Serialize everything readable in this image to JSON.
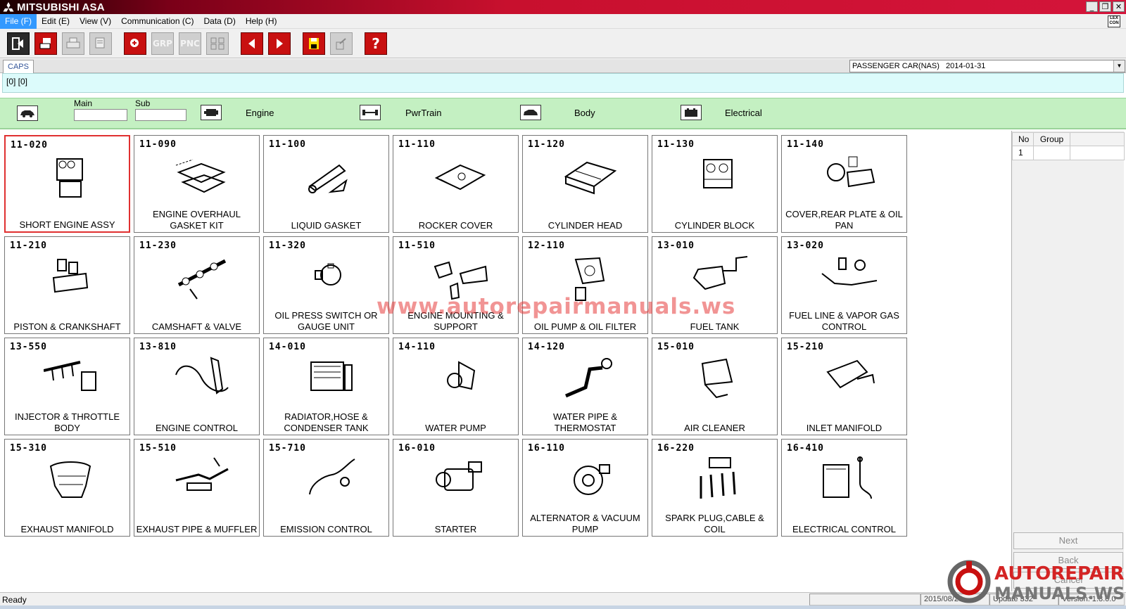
{
  "window": {
    "title": "MITSUBISHI ASA",
    "minimize": "_",
    "restore": "❐",
    "close": "✕"
  },
  "menu": [
    "File (F)",
    "Edit (E)",
    "View (V)",
    "Communication (C)",
    "Data (D)",
    "Help (H)"
  ],
  "menu_icon_text": "LEX CON",
  "toolbar": {
    "grp": "GRP",
    "pnc": "PNC",
    "help": "?"
  },
  "caps_tab": "CAPS",
  "vehicle": "PASSENGER CAR(NAS)   2014-01-31",
  "path": "[0] [0]",
  "category": {
    "main_label": "Main",
    "sub_label": "Sub",
    "engine": "Engine",
    "pwrtrain": "PwrTrain",
    "body": "Body",
    "electrical": "Electrical"
  },
  "tiles": [
    {
      "code": "11-020",
      "name": "SHORT ENGINE ASSY"
    },
    {
      "code": "11-090",
      "name": "ENGINE OVERHAUL GASKET KIT"
    },
    {
      "code": "11-100",
      "name": "LIQUID GASKET"
    },
    {
      "code": "11-110",
      "name": "ROCKER COVER"
    },
    {
      "code": "11-120",
      "name": "CYLINDER HEAD"
    },
    {
      "code": "11-130",
      "name": "CYLINDER BLOCK"
    },
    {
      "code": "11-140",
      "name": "COVER,REAR PLATE & OIL PAN"
    },
    {
      "code": "11-210",
      "name": "PISTON & CRANKSHAFT"
    },
    {
      "code": "11-230",
      "name": "CAMSHAFT & VALVE"
    },
    {
      "code": "11-320",
      "name": "OIL PRESS SWITCH OR GAUGE UNIT"
    },
    {
      "code": "11-510",
      "name": "ENGINE MOUNTING & SUPPORT"
    },
    {
      "code": "12-110",
      "name": "OIL PUMP & OIL FILTER"
    },
    {
      "code": "13-010",
      "name": "FUEL TANK"
    },
    {
      "code": "13-020",
      "name": "FUEL LINE & VAPOR GAS CONTROL"
    },
    {
      "code": "13-550",
      "name": "INJECTOR & THROTTLE BODY"
    },
    {
      "code": "13-810",
      "name": "ENGINE CONTROL"
    },
    {
      "code": "14-010",
      "name": "RADIATOR,HOSE & CONDENSER TANK"
    },
    {
      "code": "14-110",
      "name": "WATER PUMP"
    },
    {
      "code": "14-120",
      "name": "WATER PIPE & THERMOSTAT"
    },
    {
      "code": "15-010",
      "name": "AIR CLEANER"
    },
    {
      "code": "15-210",
      "name": "INLET MANIFOLD"
    },
    {
      "code": "15-310",
      "name": "EXHAUST MANIFOLD"
    },
    {
      "code": "15-510",
      "name": "EXHAUST PIPE & MUFFLER"
    },
    {
      "code": "15-710",
      "name": "EMISSION CONTROL"
    },
    {
      "code": "16-010",
      "name": "STARTER"
    },
    {
      "code": "16-110",
      "name": "ALTERNATOR & VACUUM PUMP"
    },
    {
      "code": "16-220",
      "name": "SPARK PLUG,CABLE & COIL"
    },
    {
      "code": "16-410",
      "name": "ELECTRICAL CONTROL"
    }
  ],
  "watermark": "www.autorepairmanuals.ws",
  "group_table": {
    "col_no": "No",
    "col_group": "Group",
    "rows": [
      {
        "no": "1",
        "group": ""
      }
    ]
  },
  "panel_buttons": {
    "next": "Next",
    "back": "Back",
    "cancel": "Cancel"
  },
  "status": {
    "ready": "Ready",
    "date": "2015/08/28",
    "update": "Update 332",
    "version": "Version: 1.8.0.0"
  },
  "brand": {
    "line1": "AUTOREPAIR",
    "line2": "MANUALS.WS"
  },
  "colors": {
    "accent_red": "#c8102e",
    "category_green": "#c4f0c2",
    "path_cyan": "#dcfbfb",
    "selected_tile": "#e03030"
  }
}
